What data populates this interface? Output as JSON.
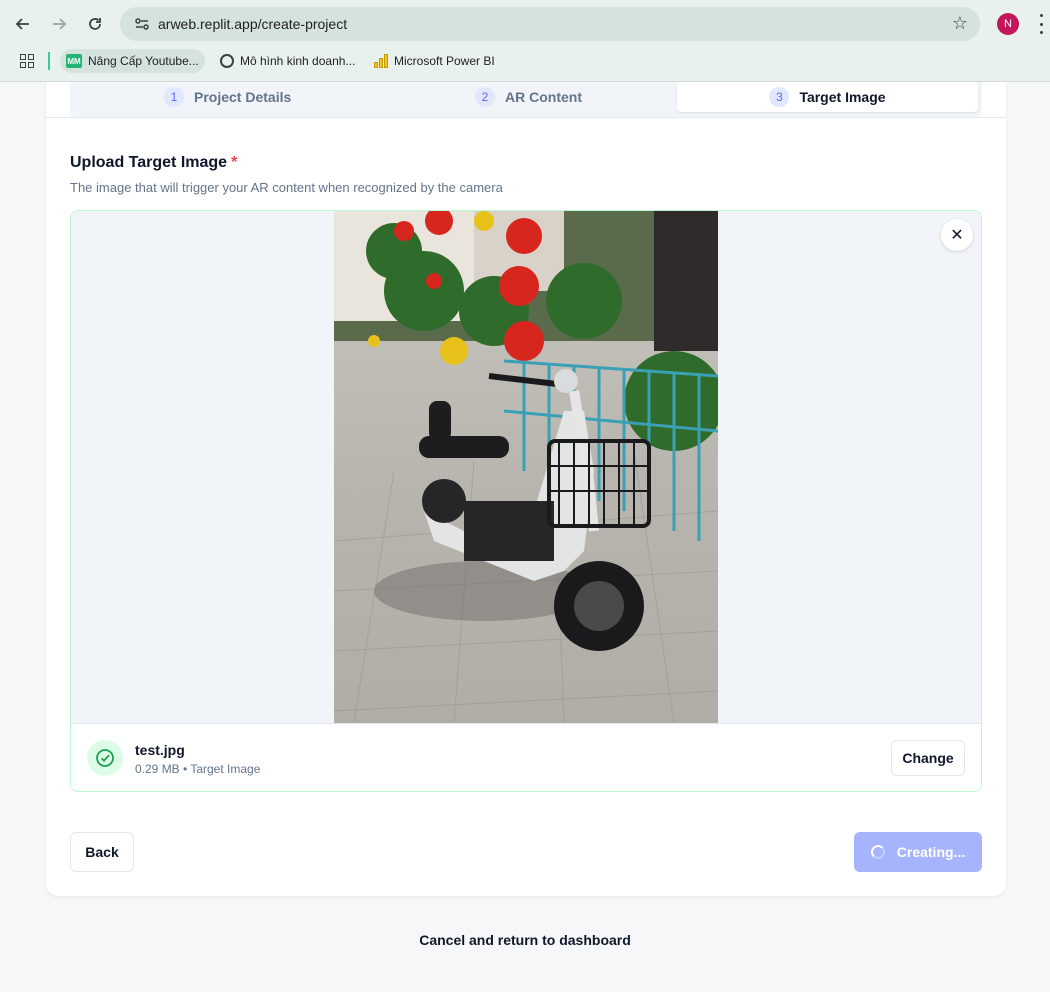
{
  "browser": {
    "url": "arweb.replit.app/create-project",
    "profile_initial": "N",
    "bookmarks": [
      {
        "label": "Nâng Cấp Youtube...",
        "icon": "mm-favicon"
      },
      {
        "label": "Mô hình kinh doanh...",
        "icon": "chatgpt-icon"
      },
      {
        "label": "Microsoft Power BI",
        "icon": "powerbi-icon"
      }
    ],
    "bookmark_mm_text": "MM"
  },
  "steps": [
    {
      "num": "1",
      "label": "Project Details"
    },
    {
      "num": "2",
      "label": "AR Content"
    },
    {
      "num": "3",
      "label": "Target Image"
    }
  ],
  "upload": {
    "title": "Upload Target Image",
    "required_mark": "*",
    "description": "The image that will trigger your AR content when recognized by the camera",
    "close_symbol": "✕",
    "file_name": "test.jpg",
    "file_meta": "0.29 MB • Target Image",
    "change_label": "Change"
  },
  "actions": {
    "back_label": "Back",
    "create_label": "Creating...",
    "cancel_label": "Cancel and return to dashboard"
  },
  "colors": {
    "accent_disabled": "#a5b4fc",
    "success_bg": "#dcfce7",
    "success": "#16a34a",
    "required": "#ef4444"
  }
}
